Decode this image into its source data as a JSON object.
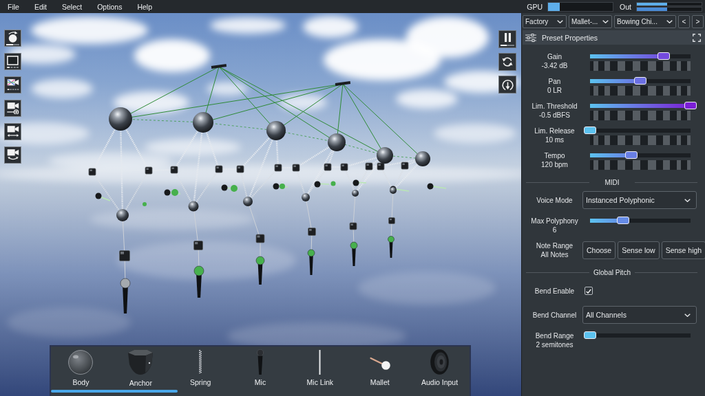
{
  "menu": [
    "File",
    "Edit",
    "Select",
    "Options",
    "Help"
  ],
  "meters": [
    {
      "label": "GPU",
      "bars": [
        {
          "level": 0.18
        }
      ]
    },
    {
      "label": "Out",
      "bars": [
        {
          "level": 0.47
        },
        {
          "level": 0.47
        }
      ]
    }
  ],
  "viewport": {
    "left_toolbar": [
      {
        "kind": "drop",
        "level": 0.55
      },
      {
        "kind": "screen"
      },
      {
        "kind": "crosscam"
      },
      {
        "kind": "zoomcam"
      },
      {
        "kind": "pancam"
      },
      {
        "kind": "orbitcam"
      }
    ],
    "right_toolbar": [
      {
        "kind": "pause",
        "level": 0.45
      },
      {
        "kind": "refresh"
      },
      {
        "kind": "reset"
      }
    ],
    "palette": [
      {
        "kind": "body",
        "label": "Body"
      },
      {
        "kind": "anchor",
        "label": "Anchor"
      },
      {
        "kind": "spring",
        "label": "Spring"
      },
      {
        "kind": "mic",
        "label": "Mic"
      },
      {
        "kind": "link",
        "label": "Mic Link"
      },
      {
        "kind": "mallet",
        "label": "Mallet"
      },
      {
        "kind": "input",
        "label": "Audio Input"
      }
    ]
  },
  "panel": {
    "presets": [
      {
        "value": "Factory"
      },
      {
        "value": "Mallet-..."
      },
      {
        "value": "Bowing Chi..."
      }
    ],
    "nav": [
      "<",
      ">"
    ],
    "title": "Preset Properties",
    "rows": [
      {
        "kind": "slider",
        "label": "Gain",
        "reading": "-3.42 dB",
        "level": 0.73,
        "lane": true
      },
      {
        "kind": "slider",
        "label": "Pan",
        "reading": "0 LR",
        "level": 0.5,
        "lane": true
      },
      {
        "kind": "slider",
        "label": "Lim. Threshold",
        "reading": "-0.5 dBFS",
        "level": 1,
        "lane": true
      },
      {
        "kind": "slider",
        "label": "Lim. Release",
        "reading": "10 ms",
        "level": 0,
        "lane": true
      },
      {
        "kind": "slider",
        "label": "Tempo",
        "reading": "120 bpm",
        "level": 0.41,
        "lane": true
      },
      {
        "kind": "heading",
        "label": "MIDI"
      },
      {
        "kind": "dropdown",
        "label": "Voice Mode",
        "value": "Instanced Polyphonic"
      },
      {
        "kind": "slider",
        "label": "Max Polyphony",
        "reading": "6",
        "level": 0.33,
        "lane": false
      },
      {
        "kind": "buttons",
        "label": "Note Range",
        "reading": "All Notes",
        "buttons": [
          "Choose",
          "Sense low",
          "Sense high"
        ]
      },
      {
        "kind": "heading",
        "label": "Global Pitch"
      },
      {
        "kind": "checkbox",
        "label": "Bend Enable",
        "checked": true
      },
      {
        "kind": "dropdown",
        "label": "Bend Channel",
        "value": "All Channels"
      },
      {
        "kind": "slider",
        "label": "Bend Range",
        "reading": "2 semitones",
        "level": 0,
        "lane": false
      }
    ]
  }
}
